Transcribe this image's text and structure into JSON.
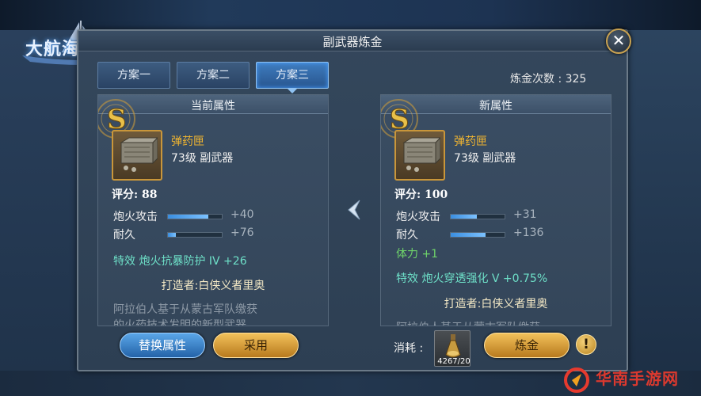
{
  "game_logo": "大航海之路",
  "dialog": {
    "title": "副武器炼金",
    "tabs": [
      {
        "label": "方案一",
        "active": false
      },
      {
        "label": "方案二",
        "active": false
      },
      {
        "label": "方案三",
        "active": true
      }
    ],
    "refine_count_label": "炼金次数 : 325"
  },
  "left_panel": {
    "header": "当前属性",
    "item_name": "弹药匣",
    "item_level": "73级 副武器",
    "score": "评分: 88",
    "stats": [
      {
        "label": "炮火攻击",
        "fill": 0.75,
        "value": "+40"
      },
      {
        "label": "耐久",
        "fill": 0.15,
        "value": "+76"
      }
    ],
    "special": "特效  炮火抗暴防护 IV +26",
    "maker": "打造者:白侠义者里奥",
    "desc_line1": "阿拉伯人基于从蒙古军队缴获",
    "desc_line2": "的火药技术发明的新型武器"
  },
  "right_panel": {
    "header": "新属性",
    "item_name": "弹药匣",
    "item_level": "73级 副武器",
    "score": "评分: 100",
    "stats": [
      {
        "label": "炮火攻击",
        "fill": 0.48,
        "value": "+31"
      },
      {
        "label": "耐久",
        "fill": 0.65,
        "value": "+136"
      }
    ],
    "extra": "体力 +1",
    "special": "特效  炮火穿透强化 V +0.75%",
    "maker": "打造者:白侠义者里奥",
    "desc_line1": "阿拉伯人基于从蒙古军队缴获"
  },
  "buttons": {
    "swap": "替换属性",
    "apply": "采用",
    "refine": "炼金"
  },
  "consume": {
    "label": "消耗 :",
    "count": "4267/20"
  },
  "watermark": "华南手游网",
  "colors": {
    "gold_text": "#f0b531",
    "special_text": "#6ee0c8",
    "green_text": "#6fd46a",
    "accent_blue": "#3a8ee0"
  },
  "icons": {
    "close": "close-icon",
    "swap_arrow": "chevron-left-icon",
    "warning": "exclamation-icon",
    "rank_badge": "s-rank-badge-icon",
    "item": "ammo-box-icon",
    "material": "potion-flask-icon"
  }
}
